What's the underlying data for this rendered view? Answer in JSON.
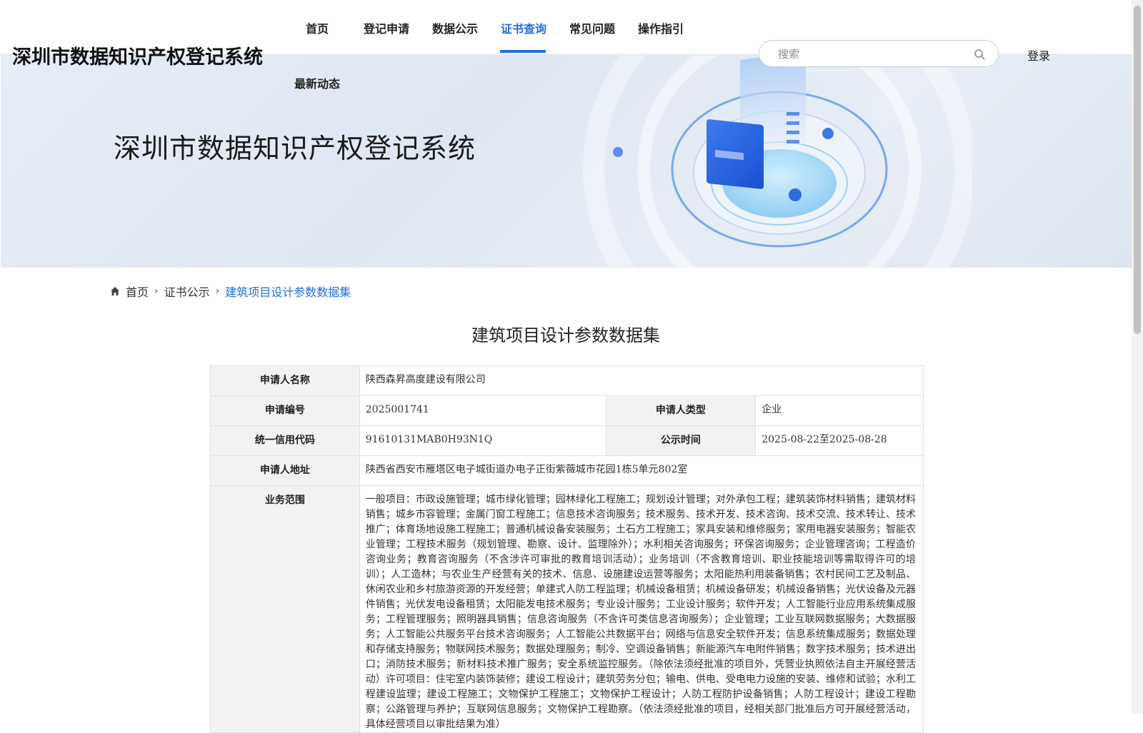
{
  "header": {
    "site_title": "深圳市数据知识产权登记系统",
    "nav": [
      {
        "label": "首页"
      },
      {
        "label": "登记申请"
      },
      {
        "label": "数据公示"
      },
      {
        "label": "证书查询"
      },
      {
        "label": "常见问题"
      },
      {
        "label": "操作指引"
      }
    ],
    "nav_second_row": "最新动态",
    "active_nav": "证书查询",
    "search_placeholder": "搜索",
    "login_label": "登录"
  },
  "banner": {
    "title": "深圳市数据知识产权登记系统"
  },
  "breadcrumb": {
    "home": "首页",
    "level1": "证书公示",
    "current": "建筑项目设计参数数据集"
  },
  "page_title": "建筑项目设计参数数据集",
  "info": {
    "applicant_name_label": "申请人名称",
    "applicant_name": "陕西森昇高度建设有限公司",
    "app_no_label": "申请编号",
    "app_no": "2025001741",
    "applicant_type_label": "申请人类型",
    "applicant_type": "企业",
    "credit_code_label": "统一信用代码",
    "credit_code": "91610131MAB0H93N1Q",
    "publish_time_label": "公示时间",
    "publish_time": "2025-08-22至2025-08-28",
    "address_label": "申请人地址",
    "address": "陕西省西安市雁塔区电子城街道办电子正街紫薇城市花园1栋5单元802室",
    "scope_label": "业务范围",
    "scope": "一般项目：市政设施管理；城市绿化管理；园林绿化工程施工；规划设计管理；对外承包工程；建筑装饰材料销售；建筑材料销售；城乡市容管理；金属门窗工程施工；信息技术咨询服务；技术服务、技术开发、技术咨询、技术交流、技术转让、技术推广；体育场地设施工程施工；普通机械设备安装服务；土石方工程施工；家具安装和维修服务；家用电器安装服务；智能农业管理；工程技术服务（规划管理、勘察、设计、监理除外）；水利相关咨询服务；环保咨询服务；企业管理咨询；工程造价咨询业务；教育咨询服务（不含涉许可审批的教育培训活动）；业务培训（不含教育培训、职业技能培训等需取得许可的培训）；人工造林；与农业生产经营有关的技术、信息、设施建设运营等服务；太阳能热利用装备销售；农村民间工艺及制品、休闲农业和乡村旅游资源的开发经营；单建式人防工程监理；机械设备租赁；机械设备研发；机械设备销售；光伏设备及元器件销售；光伏发电设备租赁；太阳能发电技术服务；专业设计服务；工业设计服务；软件开发；人工智能行业应用系统集成服务；工程管理服务；照明器具销售；信息咨询服务（不含许可类信息咨询服务）；企业管理；工业互联网数据服务；大数据服务；人工智能公共服务平台技术咨询服务；人工智能公共数据平台；网络与信息安全软件开发；信息系统集成服务；数据处理和存储支持服务；物联网技术服务；数据处理服务；制冷、空调设备销售；新能源汽车电附件销售；数字技术服务；技术进出口；消防技术服务；新材料技术推广服务；安全系统监控服务。（除依法须经批准的项目外，凭营业执照依法自主开展经营活动）许可项目：住宅室内装饰装修；建设工程设计；建筑劳务分包；输电、供电、受电电力设施的安装、维修和试验；水利工程建设监理；建设工程施工；文物保护工程施工；文物保护工程设计；人防工程防护设备销售；人防工程设计；建设工程勘察；公路管理与养护；互联网信息服务；文物保护工程勘察。（依法须经批准的项目，经相关部门批准后方可开展经营活动，具体经营项目以审批结果为准）"
  },
  "colors": {
    "accent": "#1f6fd6",
    "label_bg": "#f2f2f2",
    "border": "#e0e0e0"
  }
}
